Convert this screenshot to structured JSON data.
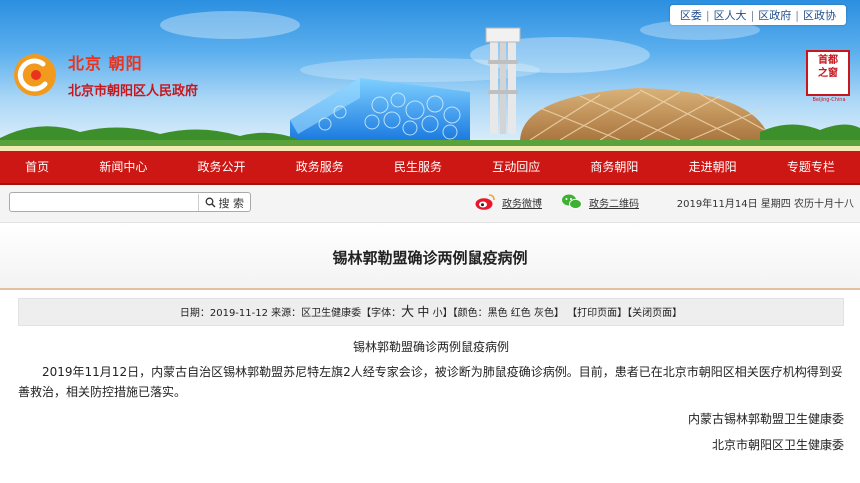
{
  "top_links": [
    "区委",
    "区人大",
    "区政府",
    "区政协"
  ],
  "logo": {
    "city": "北京 朝阳",
    "org": "北京市朝阳区人民政府"
  },
  "seal": {
    "chars": [
      "首都",
      "之窗"
    ],
    "caption": "Beijing-China"
  },
  "colors": {
    "nav_red": "#cc1714",
    "brand_red": "#c8161d"
  },
  "nav": [
    "首页",
    "新闻中心",
    "政务公开",
    "政务服务",
    "民生服务",
    "互动回应",
    "商务朝阳",
    "走进朝阳",
    "专题专栏"
  ],
  "search": {
    "placeholder": "",
    "button_label": "搜 索",
    "button_icon": "search-icon"
  },
  "social": {
    "weibo_label": "政务微博",
    "weibo_icon": "weibo-icon",
    "wechat_label": "政务二维码",
    "wechat_icon": "wechat-icon"
  },
  "date_text": "2019年11月14日 星期四 农历十月十八",
  "article": {
    "title": "锡林郭勒盟确诊两例鼠疫病例",
    "info": {
      "date_label": "日期：",
      "date": "2019-11-12",
      "source_label": "来源：",
      "source": "区卫生健康委",
      "font_label": "【字体：",
      "font_sizes": [
        "大",
        "中",
        "小"
      ],
      "font_end": "】",
      "color_label": "【颜色：",
      "colors": [
        "黑色",
        "红色",
        "灰色"
      ],
      "color_end": "】",
      "print": "【打印页面】",
      "close": "【关闭页面】"
    },
    "subhead": "锡林郭勒盟确诊两例鼠疫病例",
    "paragraph": "2019年11月12日，内蒙古自治区锡林郭勒盟苏尼特左旗2人经专家会诊，被诊断为肺鼠疫确诊病例。目前，患者已在北京市朝阳区相关医疗机构得到妥善救治，相关防控措施已落实。",
    "signature": [
      "内蒙古锡林郭勒盟卫生健康委",
      "北京市朝阳区卫生健康委"
    ]
  }
}
